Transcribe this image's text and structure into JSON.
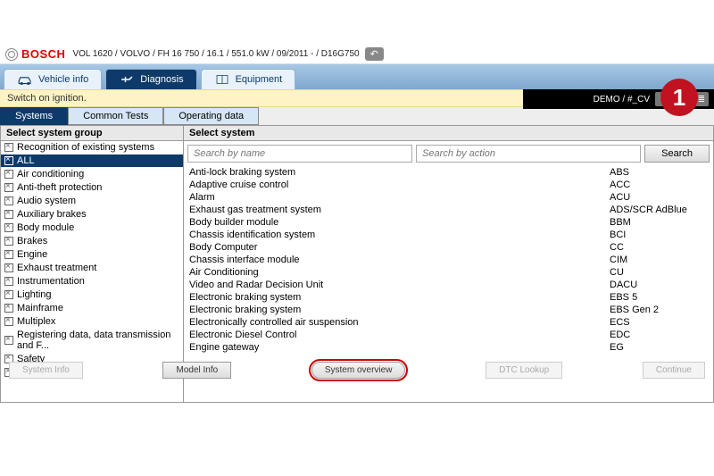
{
  "brand": "BOSCH",
  "vehicle_path": "VOL 1620 / VOLVO / FH 16 750 / 16.1 / 551.0 kW / 09/2011 - / D16G750",
  "user_label": "DEMO / #_CV",
  "main_tabs": [
    {
      "label": "Vehicle info"
    },
    {
      "label": "Diagnosis"
    },
    {
      "label": "Equipment"
    }
  ],
  "info_message": "Switch on ignition.",
  "sub_tabs": [
    {
      "label": "Systems"
    },
    {
      "label": "Common Tests"
    },
    {
      "label": "Operating data"
    }
  ],
  "left_header": "Select system group",
  "right_header": "Select system",
  "search": {
    "name_placeholder": "Search by name",
    "action_placeholder": "Search by action",
    "button": "Search"
  },
  "groups": [
    "Recognition of existing systems",
    "ALL",
    "Air conditioning",
    "Anti-theft protection",
    "Audio system",
    "Auxiliary brakes",
    "Body module",
    "Brakes",
    "Engine",
    "Exhaust treatment",
    "Instrumentation",
    "Lighting",
    "Mainframe",
    "Multiplex",
    "Registering data, data transmission and F...",
    "Safety",
    "Steering"
  ],
  "selected_group_index": 1,
  "systems": [
    {
      "name": "Anti-lock braking system",
      "code": "ABS"
    },
    {
      "name": "Adaptive cruise control",
      "code": "ACC"
    },
    {
      "name": "Alarm",
      "code": "ACU"
    },
    {
      "name": "Exhaust gas treatment system",
      "code": "ADS/SCR AdBlue"
    },
    {
      "name": "Body builder module",
      "code": "BBM"
    },
    {
      "name": "Chassis identification system",
      "code": "BCI"
    },
    {
      "name": "Body Computer",
      "code": "CC"
    },
    {
      "name": "Chassis interface module",
      "code": "CIM"
    },
    {
      "name": "Air Conditioning",
      "code": "CU"
    },
    {
      "name": "Video and Radar Decision Unit",
      "code": "DACU"
    },
    {
      "name": "Electronic braking system",
      "code": "EBS 5"
    },
    {
      "name": "Electronic braking system",
      "code": "EBS Gen 2"
    },
    {
      "name": "Electronically controlled air suspension",
      "code": "ECS"
    },
    {
      "name": "Electronic Diesel Control",
      "code": "EDC"
    },
    {
      "name": "Engine gateway",
      "code": "EG"
    }
  ],
  "bottom_buttons": {
    "system_info": "System Info",
    "model_info": "Model Info",
    "system_overview": "System overview",
    "dtc_lookup": "DTC Lookup",
    "continue": "Continue"
  },
  "badge": "1"
}
